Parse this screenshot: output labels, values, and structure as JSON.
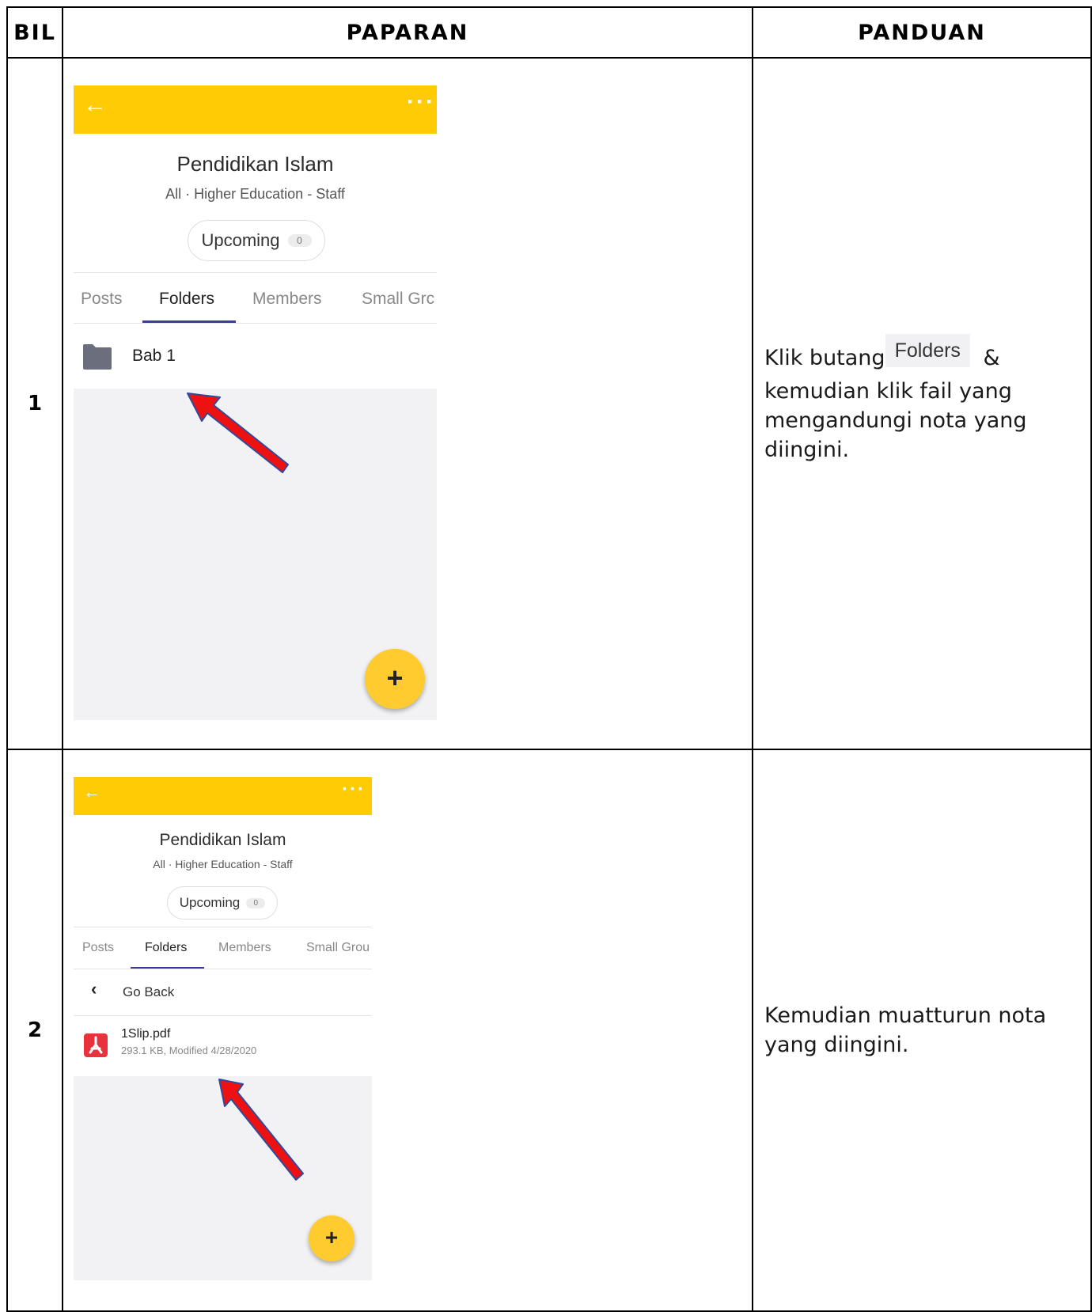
{
  "header": {
    "col_bil": "BIL",
    "col_paparan": "PAPARAN",
    "col_panduan": "PANDUAN"
  },
  "rows": [
    {
      "bil": "1",
      "screen": {
        "group_name": "Pendidikan Islam",
        "group_subtitle": "All · Higher Education - Staff",
        "upcoming_label": "Upcoming",
        "upcoming_count": "0",
        "tabs": [
          "Posts",
          "Folders",
          "Members",
          "Small Grc"
        ],
        "active_tab": "Folders",
        "folder_name": "Bab 1",
        "fab_symbol": "+"
      },
      "panduan": {
        "before": "Klik butang",
        "chip": "Folders",
        "after": "&",
        "rest": "kemudian klik fail yang mengandungi nota yang diingini."
      }
    },
    {
      "bil": "2",
      "screen": {
        "group_name": "Pendidikan Islam",
        "group_subtitle": "All · Higher Education - Staff",
        "upcoming_label": "Upcoming",
        "upcoming_count": "0",
        "tabs": [
          "Posts",
          "Folders",
          "Members",
          "Small Grou"
        ],
        "active_tab": "Folders",
        "go_back_label": "Go Back",
        "file_name": "1Slip.pdf",
        "file_meta": "293.1 KB, Modified 4/28/2020",
        "fab_symbol": "+"
      },
      "panduan": {
        "text": "Kemudian muatturun nota yang diingini."
      }
    }
  ],
  "colors": {
    "topbar": "#ffcb05",
    "fab": "#ffcb2f",
    "arrow": "#ee1111",
    "tab_underline": "#3c3c9c",
    "pdf_icon": "#e8323c"
  },
  "icons": [
    "back-arrow-icon",
    "more-icon",
    "folder-icon",
    "chevron-left-icon",
    "pdf-icon",
    "plus-icon",
    "annotation-arrow-icon"
  ]
}
